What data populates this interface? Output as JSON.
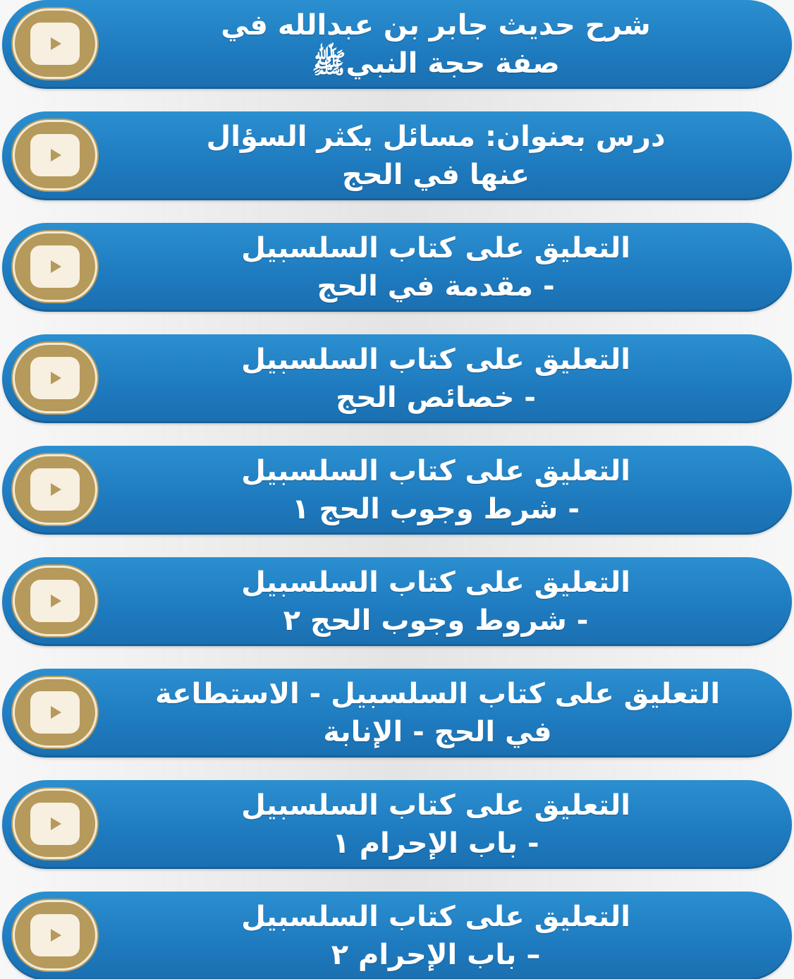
{
  "lessons": [
    {
      "line1": "شرح حديث جابر بن عبدالله في",
      "line2": "صفة حجة النبيﷺ",
      "icon": "play-icon"
    },
    {
      "line1": "درس بعنوان: مسائل يكثر السؤال",
      "line2": "عنها في الحج",
      "icon": "play-icon"
    },
    {
      "line1": "التعليق على كتاب السلسبيل",
      "line2": "- مقدمة في الحج",
      "icon": "play-icon"
    },
    {
      "line1": "التعليق على كتاب السلسبيل",
      "line2": "- خصائص الحج",
      "icon": "play-icon"
    },
    {
      "line1": "التعليق على كتاب السلسبيل",
      "line2": "- شرط وجوب الحج ١",
      "icon": "play-icon"
    },
    {
      "line1": "التعليق على كتاب السلسبيل",
      "line2": "- شروط وجوب الحج ٢",
      "icon": "play-icon"
    },
    {
      "line1": "التعليق على كتاب السلسبيل - الاستطاعة",
      "line2": "في الحج - الإنابة",
      "icon": "play-icon"
    },
    {
      "line1": "التعليق على كتاب السلسبيل",
      "line2": "- باب الإحرام ١",
      "icon": "play-icon"
    },
    {
      "line1": "التعليق على كتاب السلسبيل",
      "line2": "– باب الإحرام ٢",
      "icon": "play-icon"
    }
  ],
  "colors": {
    "button_blue": "#1f7cc0",
    "play_gold": "#b69a5c",
    "play_cream": "#f7efe0",
    "text": "#ffffff"
  }
}
